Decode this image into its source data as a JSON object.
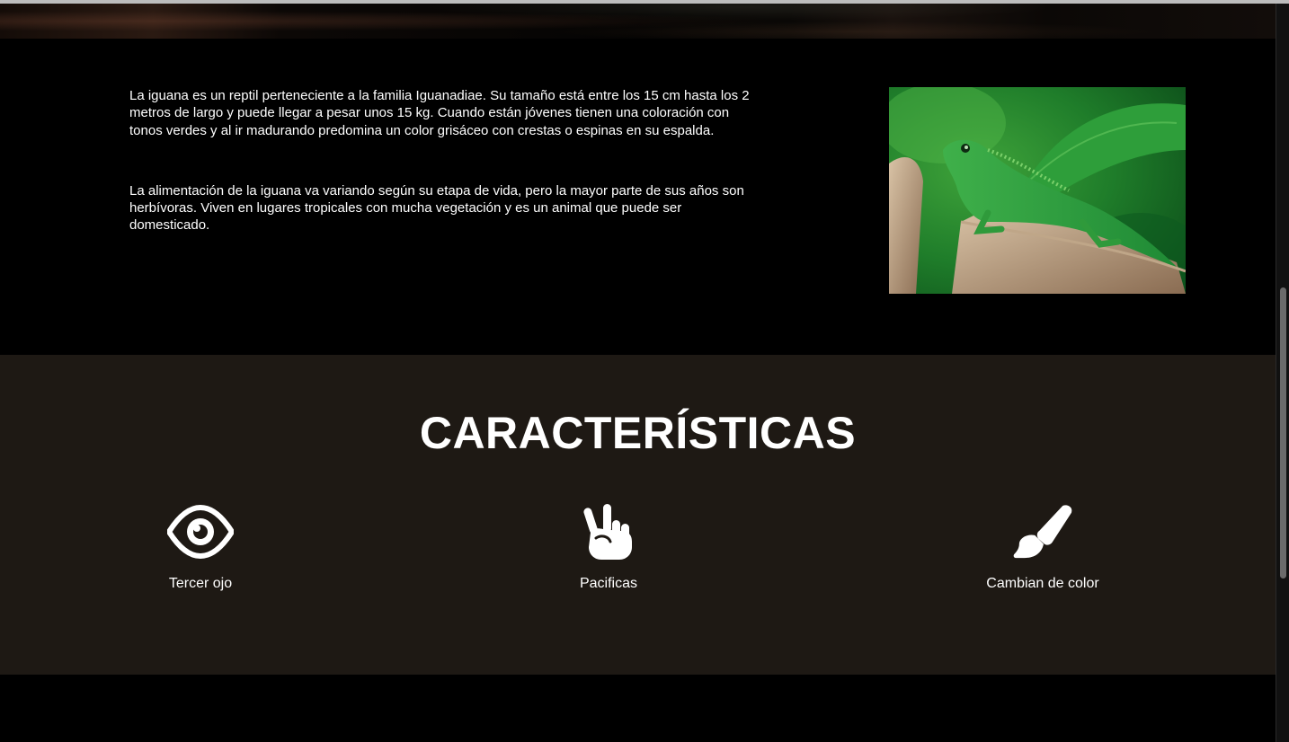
{
  "intro": {
    "paragraph1": "La iguana es un reptil perteneciente a la familia Iguanadiae. Su tamaño está entre los 15 cm hasta los 2 metros de largo y puede llegar a pesar unos 15 kg. Cuando están jóvenes tienen una coloración con tonos verdes y al ir madurando predomina un color grisáceo con crestas o espinas en su espalda.",
    "paragraph2": "La alimentación de la iguana va variando según su etapa de vida, pero la mayor parte de sus años son herbívoras. Viven en lugares tropicales con mucha vegetación y es un animal que puede ser domesticado."
  },
  "features": {
    "title": "CARACTERÍSTICAS",
    "items": [
      {
        "label": "Tercer ojo",
        "icon": "eye-icon"
      },
      {
        "label": "Pacificas",
        "icon": "peace-hand-icon"
      },
      {
        "label": "Cambian de color",
        "icon": "paintbrush-icon"
      }
    ]
  },
  "colors": {
    "page_background": "#000000",
    "features_background": "#1e1914",
    "text": "#ffffff"
  }
}
